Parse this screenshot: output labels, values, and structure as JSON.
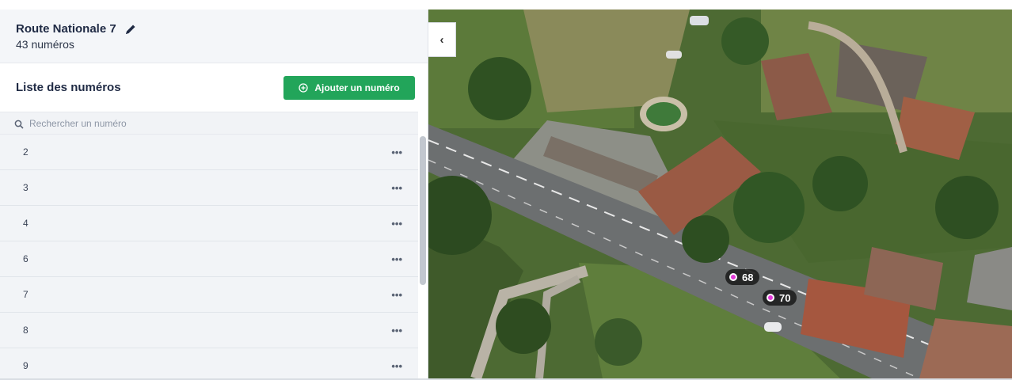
{
  "street": {
    "name": "Route Nationale 7",
    "count_label": "43 numéros"
  },
  "list": {
    "title": "Liste des numéros",
    "add_button_label": "Ajouter un numéro",
    "search_placeholder": "Rechercher un numéro",
    "rows": [
      {
        "number": "2",
        "more": "•••"
      },
      {
        "number": "3",
        "more": "•••"
      },
      {
        "number": "4",
        "more": "•••"
      },
      {
        "number": "6",
        "more": "•••"
      },
      {
        "number": "7",
        "more": "•••"
      },
      {
        "number": "8",
        "more": "•••"
      },
      {
        "number": "9",
        "more": "•••"
      }
    ]
  },
  "map": {
    "collapse_label": "‹",
    "markers": [
      {
        "label": "68"
      },
      {
        "label": "70"
      }
    ]
  },
  "colors": {
    "accent_green": "#22a55a",
    "marker_pink": "#e23ad7"
  }
}
